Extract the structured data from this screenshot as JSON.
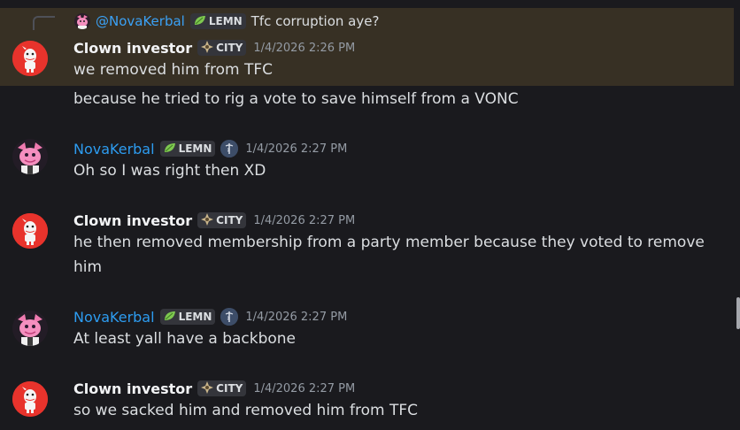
{
  "reply": {
    "author": "@NovaKerbal",
    "tag": "LEMN",
    "text": "Tfc corruption aye?"
  },
  "messages": [
    {
      "author": "Clown investor",
      "tag": "CITY",
      "timestamp": "1/4/2026 2:26 PM",
      "lines": [
        "we removed him from TFC",
        "because he tried to rig a vote to save himself from a VONC"
      ]
    },
    {
      "author": "NovaKerbal",
      "tag": "LEMN",
      "timestamp": "1/4/2026 2:27 PM",
      "lines": [
        "Oh so I was right then XD"
      ]
    },
    {
      "author": "Clown investor",
      "tag": "CITY",
      "timestamp": "1/4/2026 2:27 PM",
      "lines": [
        "he then removed membership from a party member because they voted to remove",
        "him"
      ]
    },
    {
      "author": "NovaKerbal",
      "tag": "LEMN",
      "timestamp": "1/4/2026 2:27 PM",
      "lines": [
        "At least yall have a backbone"
      ]
    },
    {
      "author": "Clown investor",
      "tag": "CITY",
      "timestamp": "1/4/2026 2:27 PM",
      "lines": [
        "so we sacked him and removed him from TFC"
      ]
    }
  ],
  "colors": {
    "background": "#1a1a1e",
    "reply_highlight": "#373024",
    "nova_name": "#2d9cf0",
    "clown_avatar": "#e8332c"
  },
  "icons": {
    "lemn_tag": "leaf-icon",
    "city_tag": "compass-icon",
    "nova_role": "caduceus-icon"
  }
}
